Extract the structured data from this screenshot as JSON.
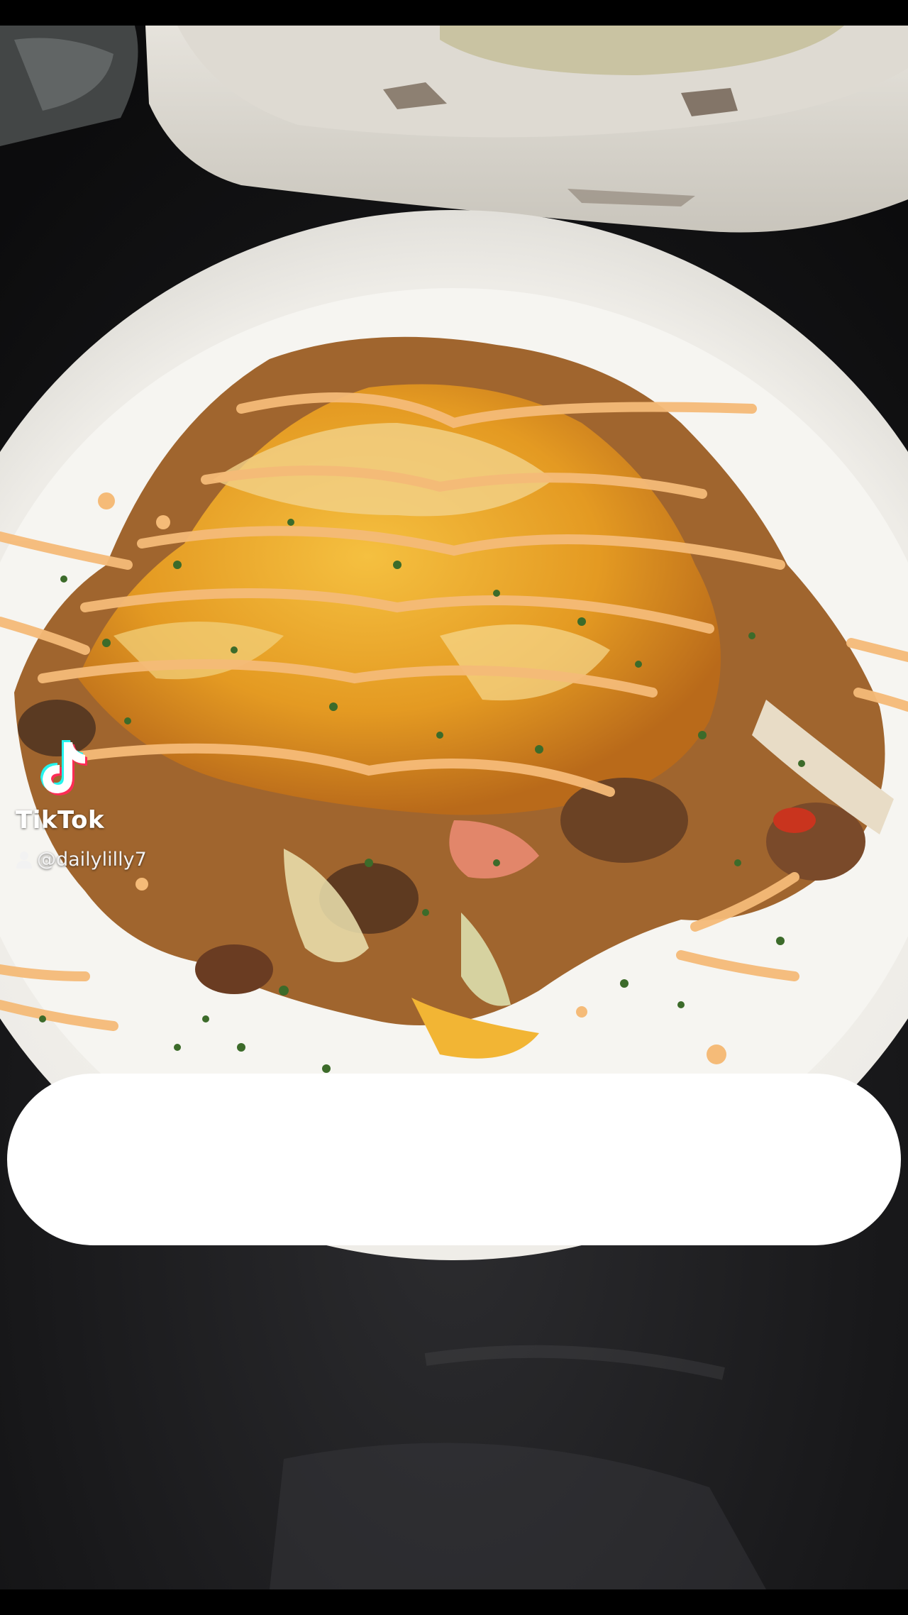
{
  "app": {
    "name": "TikTok"
  },
  "watermark": {
    "brand_label": "TikTok",
    "handle": "@dailylilly7",
    "logo_icon": "tiktok-note-icon",
    "user_icon": "person-icon"
  },
  "caption_bubble": {
    "text": ""
  },
  "colors": {
    "logo_cyan": "#25F4EE",
    "logo_red": "#FE2C55",
    "plate": "#f4f3ef",
    "cheese": "#e9a12a",
    "sauce": "#f2b36b",
    "table": "#1a1a1c"
  }
}
